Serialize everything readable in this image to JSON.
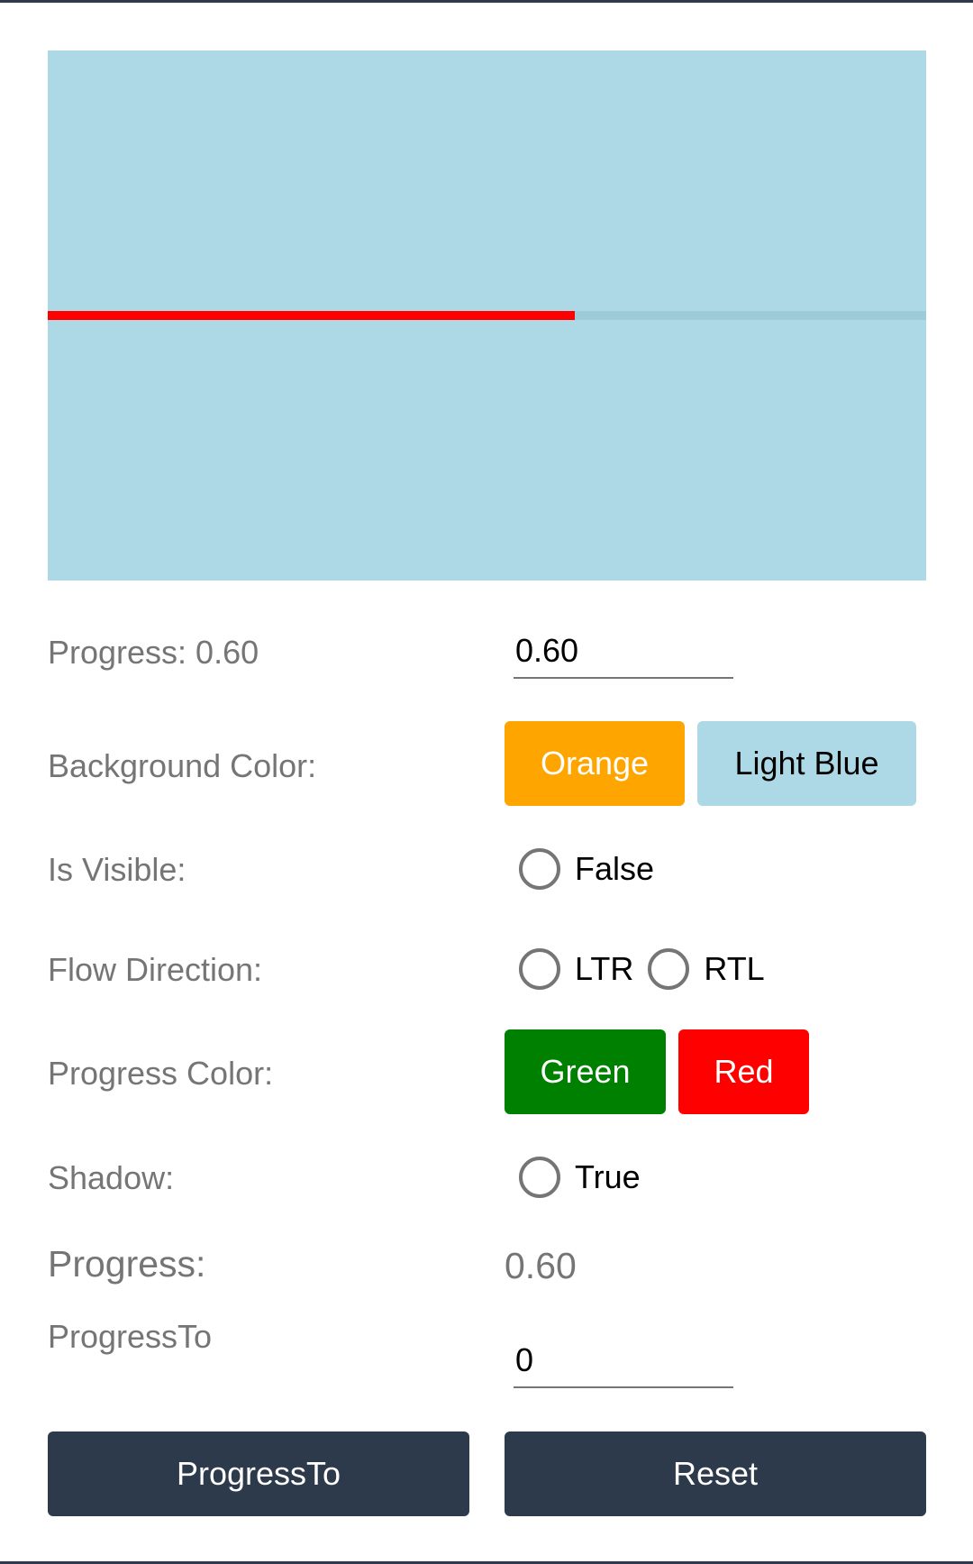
{
  "progress_bar": {
    "progress": 0.6,
    "track_color": "#9ecbd8",
    "progress_color": "#ff0000",
    "background_color": "#add8e6"
  },
  "progress_row": {
    "label": "Progress: 0.60",
    "entry_value": "0.60"
  },
  "background_color_row": {
    "label": "Background Color:",
    "orange_label": "Orange",
    "orange_color": "#ffa500",
    "light_blue_label": "Light Blue",
    "light_blue_color": "#add8e6"
  },
  "is_visible_row": {
    "label": "Is Visible:",
    "radio_label": "False"
  },
  "flow_direction_row": {
    "label": "Flow Direction:",
    "ltr_label": "LTR",
    "rtl_label": "RTL"
  },
  "progress_color_row": {
    "label": "Progress Color:",
    "green_label": "Green",
    "green_color": "#008000",
    "red_label": "Red",
    "red_color": "#ff0000"
  },
  "shadow_row": {
    "label": "Shadow:",
    "radio_label": "True"
  },
  "progress_value_row": {
    "label": "Progress:",
    "value": "0.60"
  },
  "progress_to_row": {
    "label": "ProgressTo",
    "entry_value": "0"
  },
  "actions": {
    "progress_to_label": "ProgressTo",
    "reset_label": "Reset",
    "button_color": "#2c3a4b"
  }
}
